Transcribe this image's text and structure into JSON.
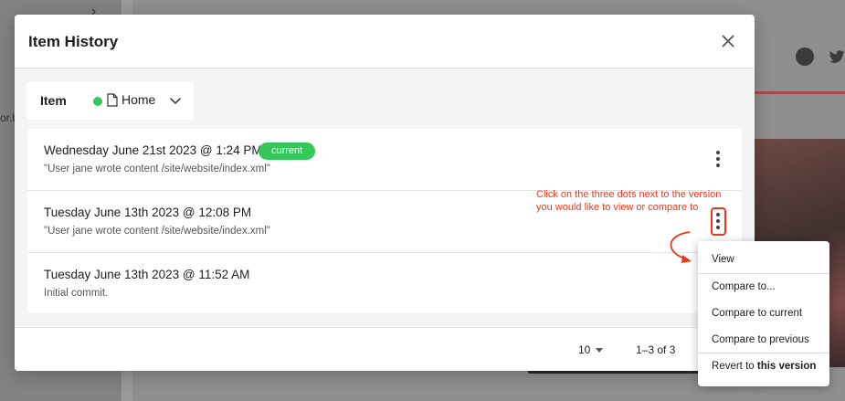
{
  "background": {
    "sidebar_text": "or.b"
  },
  "dialog": {
    "title": "Item History",
    "item_selector": {
      "label": "Item",
      "value": "Home",
      "status_color": "#34c759"
    },
    "versions": [
      {
        "date": "Wednesday June 21st 2023 @ 1:24 PM",
        "comment": "\"User jane wrote content /site/website/index.xml\"",
        "badge": "current"
      },
      {
        "date": "Tuesday June 13th 2023 @ 12:08 PM",
        "comment": "\"User jane wrote content /site/website/index.xml\"",
        "badge": null
      },
      {
        "date": "Tuesday June 13th 2023 @ 11:52 AM",
        "comment": "Initial commit.",
        "badge": null
      }
    ],
    "footer": {
      "page_size": "10",
      "range": "1–3 of 3"
    }
  },
  "annotation": {
    "text": "Click on the three dots next to the version you would like to view or compare to",
    "color": "#e8391f"
  },
  "context_menu": {
    "items": [
      "View",
      "Compare to...",
      "Compare to current",
      "Compare to previous"
    ],
    "revert_prefix": "Revert to ",
    "revert_bold": "this version"
  },
  "colors": {
    "accent_green": "#34c759",
    "annotation_red": "#e8391f"
  }
}
